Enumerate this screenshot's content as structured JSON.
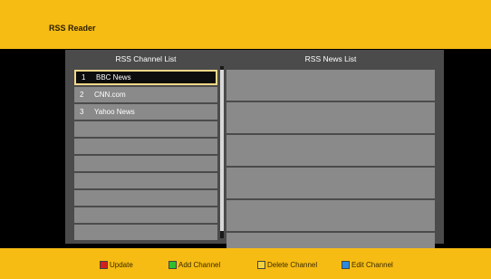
{
  "header": {
    "title": "RSS Reader"
  },
  "channel_list": {
    "heading": "RSS Channel List",
    "items": [
      {
        "num": "1",
        "name": "BBC News",
        "selected": true
      },
      {
        "num": "2",
        "name": "CNN.com",
        "selected": false
      },
      {
        "num": "3",
        "name": "Yahoo News",
        "selected": false
      },
      {
        "num": "",
        "name": "",
        "selected": false
      },
      {
        "num": "",
        "name": "",
        "selected": false
      },
      {
        "num": "",
        "name": "",
        "selected": false
      },
      {
        "num": "",
        "name": "",
        "selected": false
      },
      {
        "num": "",
        "name": "",
        "selected": false
      },
      {
        "num": "",
        "name": "",
        "selected": false
      },
      {
        "num": "",
        "name": "",
        "selected": false
      }
    ]
  },
  "news_list": {
    "heading": "RSS News List",
    "row_count": 6
  },
  "footer": {
    "actions": [
      {
        "label": "Update",
        "color": "#d21f1f",
        "icon": "red-key-icon"
      },
      {
        "label": "Add Channel",
        "color": "#2fbf2f",
        "icon": "green-key-icon"
      },
      {
        "label": "Delete Channel",
        "color": "#f2d23a",
        "icon": "yellow-key-icon"
      },
      {
        "label": "Edit Channel",
        "color": "#2a8ae0",
        "icon": "blue-key-icon"
      }
    ]
  }
}
